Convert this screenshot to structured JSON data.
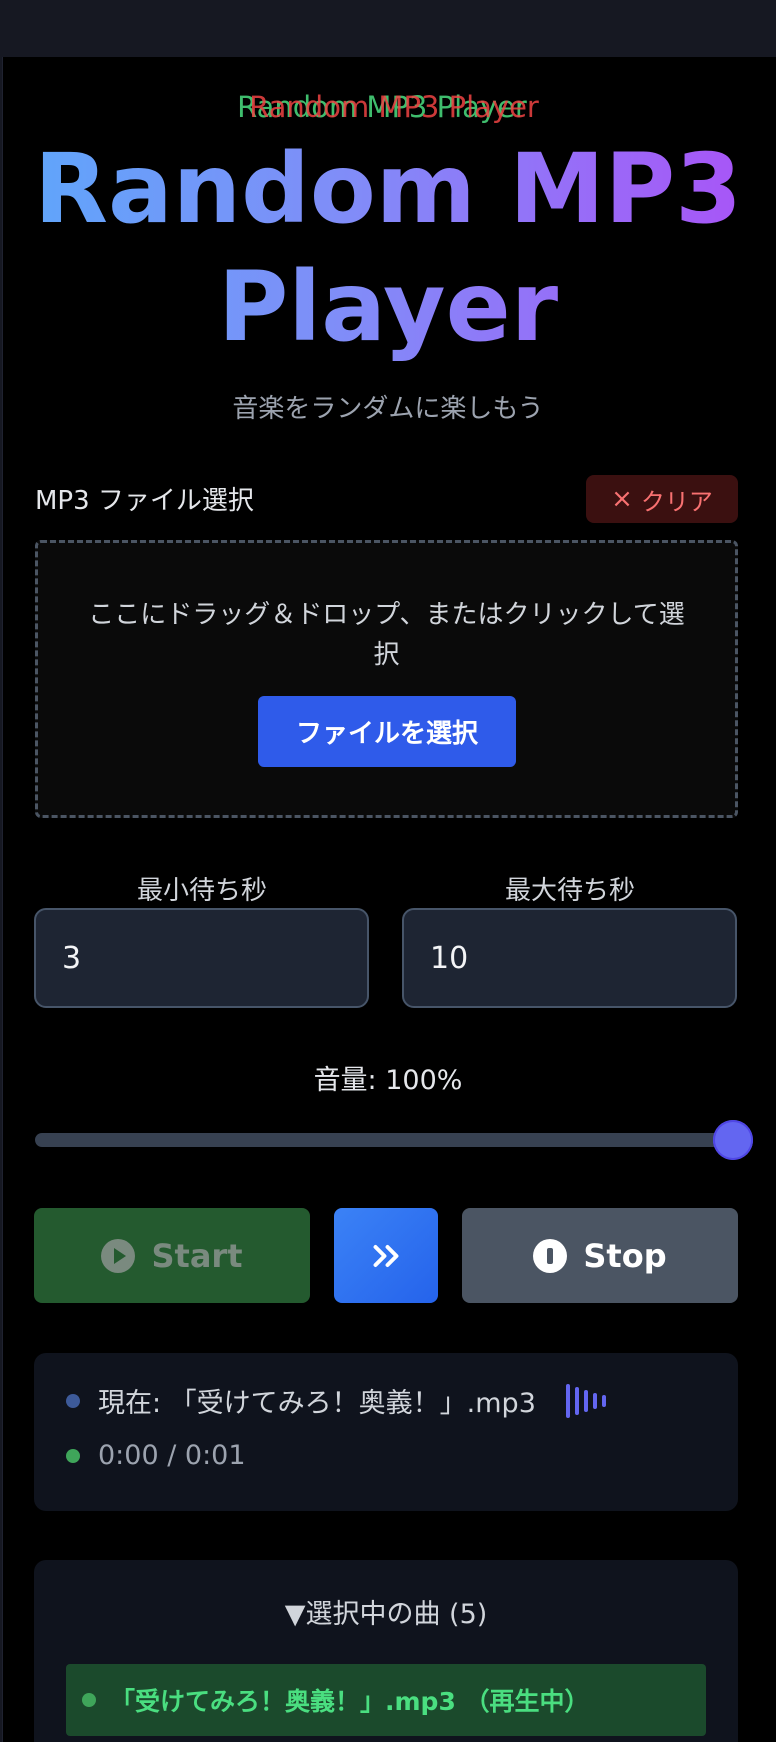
{
  "overlay_title": "Random MP3 Player",
  "title": "Random MP3 Player",
  "subtitle": "音楽をランダムに楽しもう",
  "file_section": {
    "label": "MP3 ファイル選択",
    "clear_label": "クリア",
    "drop_text": "ここにドラッグ＆ドロップ、またはクリックして選択",
    "select_button": "ファイルを選択"
  },
  "wait": {
    "min_label": "最小待ち秒",
    "min_value": "3",
    "max_label": "最大待ち秒",
    "max_value": "10"
  },
  "volume": {
    "label": "音量: 100%",
    "value_fraction": 1.0
  },
  "controls": {
    "start_label": "Start",
    "stop_label": "Stop"
  },
  "status": {
    "now_playing": "現在: 「受けてみろ！奥義！」.mp3",
    "time": "0:00 / 0:01"
  },
  "playlist": {
    "header": "▼選択中の曲 (5)",
    "items": [
      {
        "label": "「受けてみろ！奥義！」.mp3 （再生中）"
      }
    ]
  },
  "colors": {
    "background": "#000000",
    "accent": "#2f5bea",
    "start_bg": "#245a2f",
    "stop_bg": "#4b5563",
    "playing_green": "#4ade80"
  }
}
